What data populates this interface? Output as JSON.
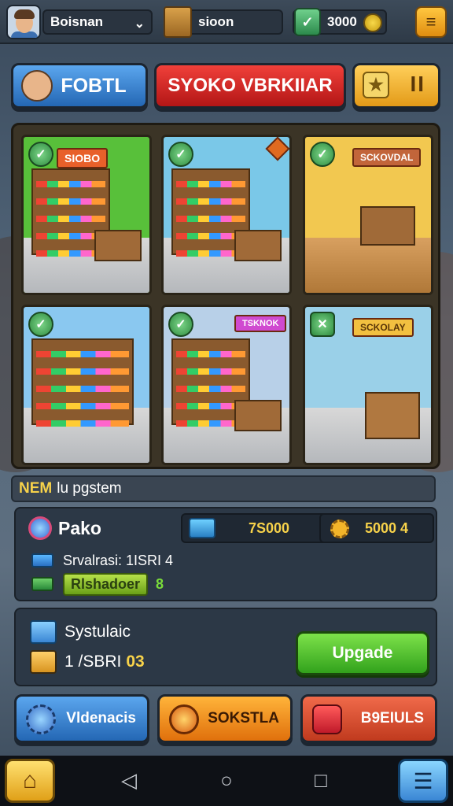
{
  "header": {
    "player_name": "Boisnan",
    "coins": "sioon",
    "gems": "3000"
  },
  "top_buttons": {
    "left": "FOBTL",
    "center": "SYOKO VBRKIIAR",
    "right_pause": "II"
  },
  "stores": [
    {
      "sign": "SIOBO",
      "wall": "#58c03a"
    },
    {
      "sign": "",
      "wall": "#7ac8e8"
    },
    {
      "sign": "SCKOVDAL",
      "wall": "#f2c850"
    },
    {
      "sign": "",
      "wall": "#8ac8f0"
    },
    {
      "sign": "TSKNOK",
      "wall": "#b8d0e8"
    },
    {
      "sign": "SCKOLAY",
      "wall": "#9ad0e8"
    }
  ],
  "news": {
    "highlight": "NEM",
    "text": "lu pgstem"
  },
  "store_panel": {
    "name": "Pako",
    "stat_blue": "7S000",
    "stat_gold": "5000  4",
    "line1": "Srvalrasi: 1ISRI 4",
    "line2_pill": "Rlshadoer",
    "line2_value": "8"
  },
  "upgrade_panel": {
    "title": "Systulaic",
    "cost_prefix": "1 /SBRI",
    "cost_value": "03",
    "upgrade_label": "Upgade"
  },
  "bottom_buttons": {
    "left": "Vldenacis",
    "center": "SOKSTLA",
    "right": "B9EIULS"
  },
  "nav": {
    "back_icon": "triangle-back-icon",
    "home_icon": "circle-home-icon",
    "recent_icon": "square-recent-icon"
  }
}
